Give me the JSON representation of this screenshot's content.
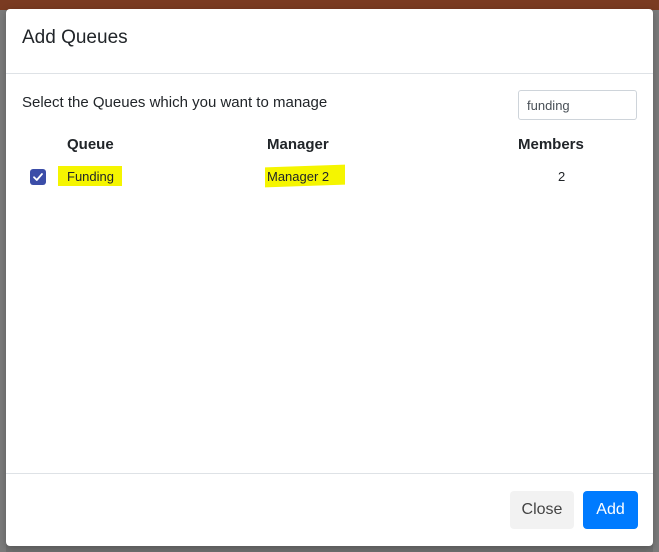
{
  "modal": {
    "title": "Add Queues",
    "instruction": "Select the Queues which you want to manage",
    "search": {
      "value": "funding",
      "placeholder": ""
    },
    "table": {
      "headers": {
        "queue": "Queue",
        "manager": "Manager",
        "members": "Members"
      },
      "rows": [
        {
          "checked": true,
          "queue": "Funding",
          "manager": "Manager 2",
          "members": "2"
        }
      ]
    },
    "footer": {
      "close_label": "Close",
      "add_label": "Add"
    }
  },
  "colors": {
    "accent": "#007bff",
    "checkbox": "#3b4da8",
    "highlight": "#f5f500"
  }
}
